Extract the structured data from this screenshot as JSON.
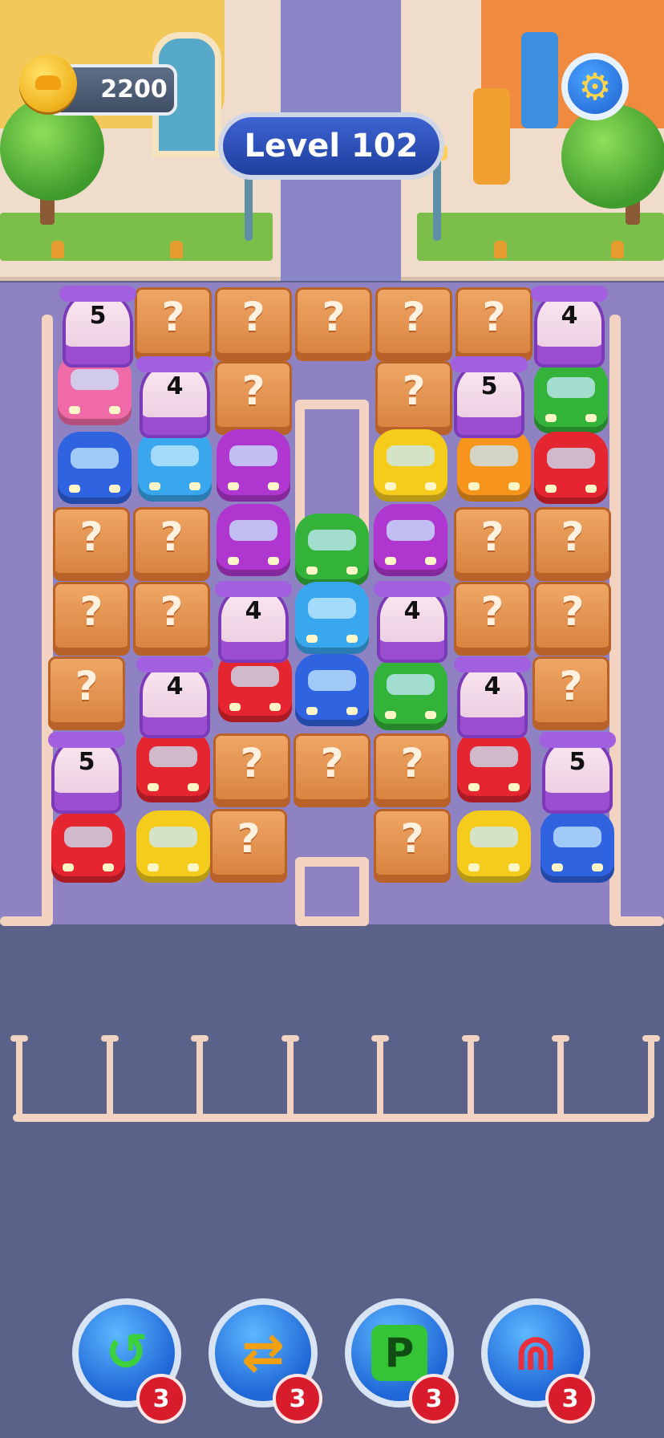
{
  "hud": {
    "coins": "2200",
    "level": "Level 102"
  },
  "board": {
    "tunnel_counts": [
      "5",
      "4",
      "4",
      "5",
      "4",
      "4",
      "4",
      "4",
      "5",
      "5"
    ],
    "crate_label": "?"
  },
  "boosters": [
    {
      "name": "undo",
      "count": "3",
      "color": "#3cd03c"
    },
    {
      "name": "shuffle",
      "count": "3",
      "color": "#f2a010"
    },
    {
      "name": "parking",
      "count": "3",
      "color": "#35c435",
      "glyph": "P"
    },
    {
      "name": "magnet",
      "count": "3",
      "color": "#e8303c"
    }
  ],
  "colors": {
    "pink": "#f06aa8",
    "blue": "#2f63e0",
    "cyan": "#39a7ee",
    "purple": "#b036d0",
    "yellow": "#f6cc1c",
    "orange": "#f7941c",
    "green": "#33b33a",
    "red": "#e5252f"
  }
}
